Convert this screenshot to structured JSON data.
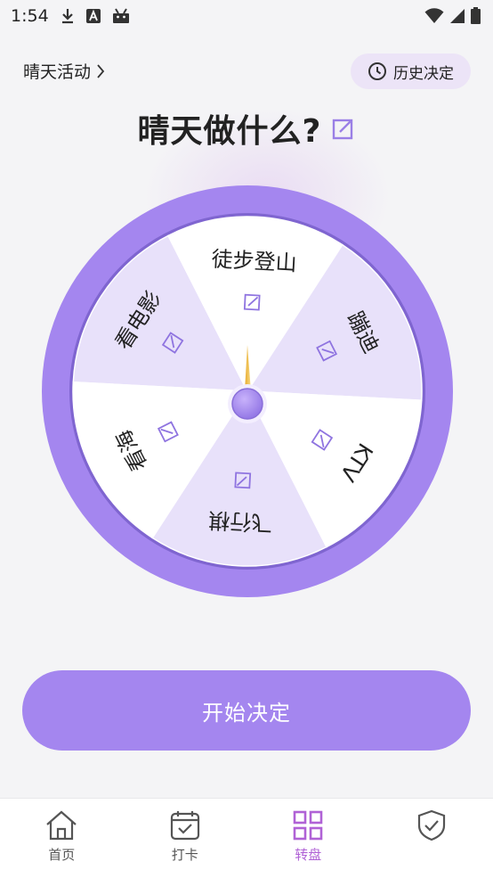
{
  "status_bar": {
    "time": "1:54"
  },
  "header": {
    "activity_link": "晴天活动",
    "history_button": "历史决定",
    "title": "晴天做什么?"
  },
  "wheel": {
    "segments": [
      {
        "label": "看电影"
      },
      {
        "label": "徒步登山"
      },
      {
        "label": "蹦迪"
      },
      {
        "label": "KTV"
      },
      {
        "label": "飞行棋"
      },
      {
        "label": "看海"
      }
    ],
    "colors": {
      "ring": "#a486ef",
      "light": "#ffffff",
      "tinted": "#e8e1fa",
      "pointer": "#f0c04a",
      "hub": "#a486ef"
    }
  },
  "actions": {
    "start_label": "开始决定"
  },
  "bottom_nav": {
    "items": [
      {
        "label": "首页",
        "icon": "home-icon",
        "active": false
      },
      {
        "label": "打卡",
        "icon": "calendar-check-icon",
        "active": false
      },
      {
        "label": "转盘",
        "icon": "grid-icon",
        "active": true
      },
      {
        "label": "",
        "icon": "shield-check-icon",
        "active": false
      }
    ]
  }
}
